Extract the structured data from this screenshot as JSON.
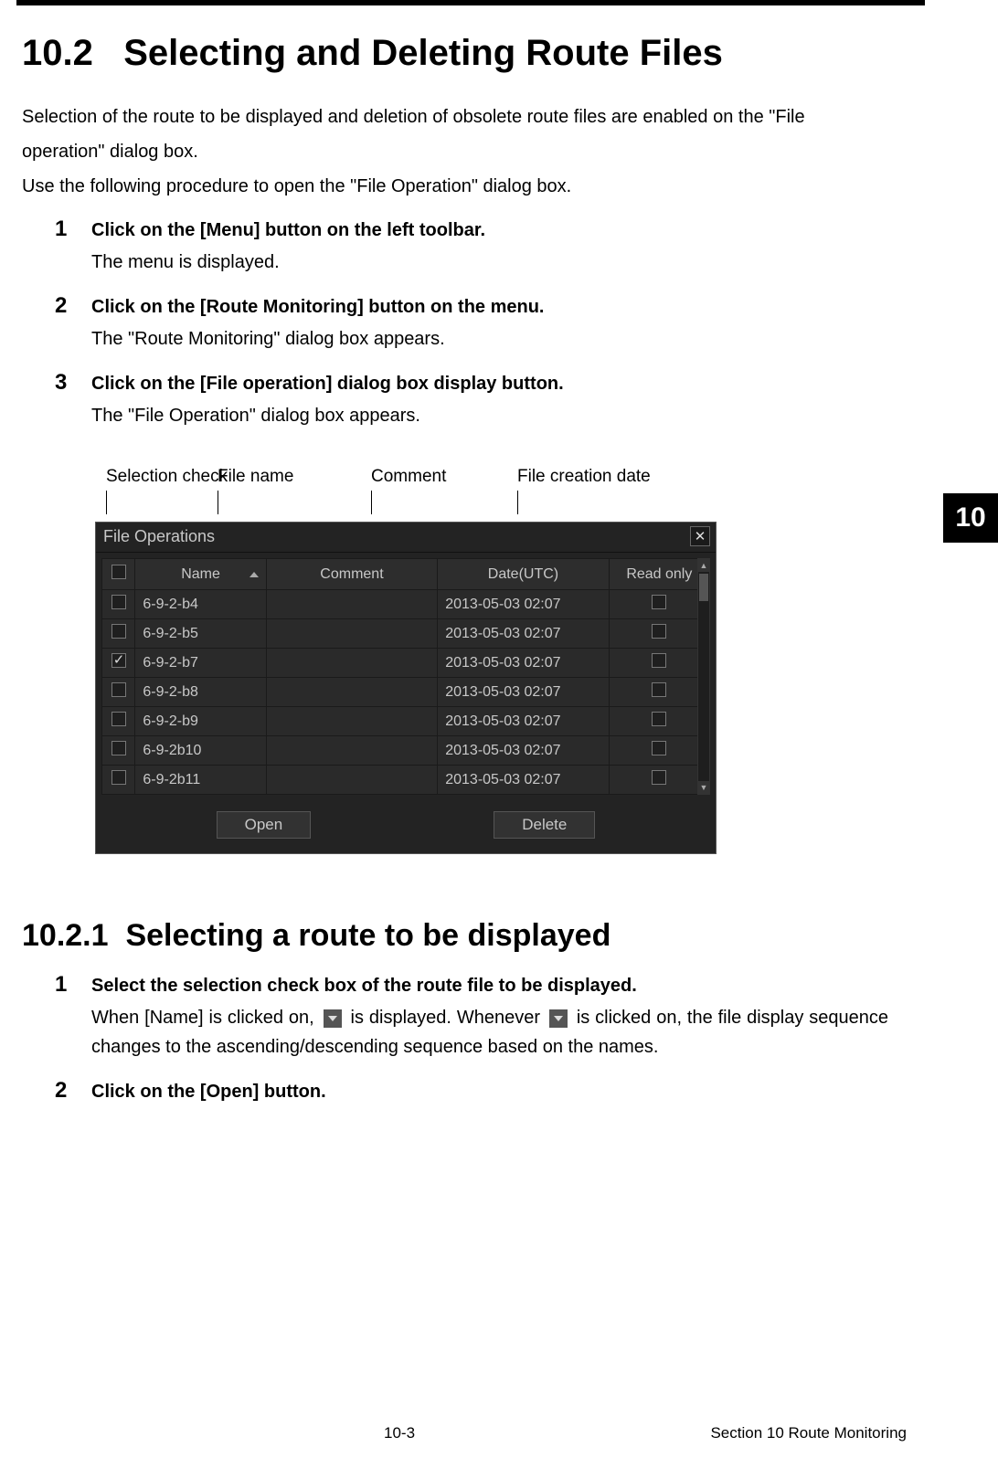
{
  "section": {
    "number": "10.2",
    "title": "Selecting and Deleting Route Files",
    "intro1": "Selection of the route to be displayed and deletion of obsolete route files are enabled on the \"File operation\" dialog box.",
    "intro2": "Use the following procedure to open the \"File Operation\" dialog box."
  },
  "steps_a": [
    {
      "num": "1",
      "title": "Click on the [Menu] button on the left toolbar.",
      "desc": "The menu is displayed."
    },
    {
      "num": "2",
      "title": "Click on the [Route Monitoring] button on the menu.",
      "desc": "The \"Route Monitoring\" dialog box appears."
    },
    {
      "num": "3",
      "title": "Click on the [File operation] dialog box display button.",
      "desc": "The \"File Operation\" dialog box appears."
    }
  ],
  "callouts": {
    "selection": "Selection check",
    "filename": "File name",
    "comment": "Comment",
    "creation": "File creation date"
  },
  "dialog": {
    "title": "File Operations",
    "headers": {
      "chk": "",
      "name": "Name",
      "comment": "Comment",
      "date": "Date(UTC)",
      "readonly": "Read only"
    },
    "rows": [
      {
        "checked": false,
        "name": "6-9-2-b4",
        "comment": "",
        "date": "2013-05-03 02:07",
        "readonly": false
      },
      {
        "checked": false,
        "name": "6-9-2-b5",
        "comment": "",
        "date": "2013-05-03 02:07",
        "readonly": false
      },
      {
        "checked": true,
        "name": "6-9-2-b7",
        "comment": "",
        "date": "2013-05-03 02:07",
        "readonly": false
      },
      {
        "checked": false,
        "name": "6-9-2-b8",
        "comment": "",
        "date": "2013-05-03 02:07",
        "readonly": false
      },
      {
        "checked": false,
        "name": "6-9-2-b9",
        "comment": "",
        "date": "2013-05-03 02:07",
        "readonly": false
      },
      {
        "checked": false,
        "name": "6-9-2b10",
        "comment": "",
        "date": "2013-05-03 02:07",
        "readonly": false
      },
      {
        "checked": false,
        "name": "6-9-2b11",
        "comment": "",
        "date": "2013-05-03 02:07",
        "readonly": false
      }
    ],
    "buttons": {
      "open": "Open",
      "delete": "Delete"
    }
  },
  "side_tab": "10",
  "subsection": {
    "number": "10.2.1",
    "title": "Selecting a route to be displayed"
  },
  "steps_b": [
    {
      "num": "1",
      "title": "Select the selection check box of the route file to be displayed.",
      "desc_pre": "When [Name] is clicked on, ",
      "desc_mid": " is displayed. Whenever ",
      "desc_post": " is clicked on, the file display sequence changes to the ascending/descending sequence based on the names."
    },
    {
      "num": "2",
      "title": "Click on the [Open] button.",
      "desc": ""
    }
  ],
  "footer": {
    "page": "10-3",
    "section": "Section 10    Route Monitoring"
  }
}
